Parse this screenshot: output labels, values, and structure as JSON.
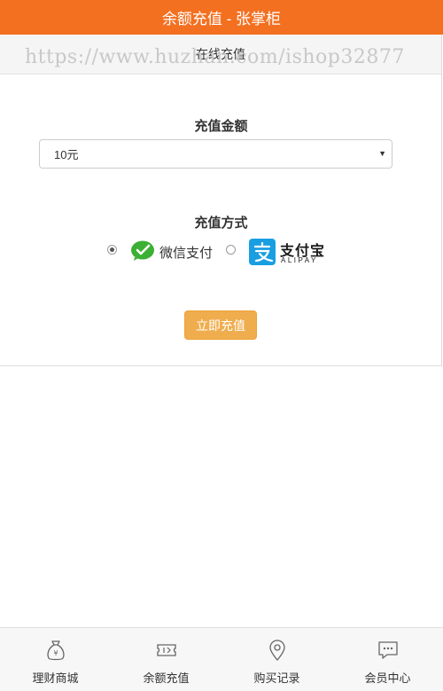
{
  "header": {
    "title": "余额充值 - 张掌柜"
  },
  "card": {
    "title": "在线充值"
  },
  "watermark": "https://www.huzhan.com/ishop32877",
  "form": {
    "amount_label": "充值金额",
    "amount_selected": "10元",
    "method_label": "充值方式",
    "methods": [
      {
        "id": "wechat",
        "label": "微信支付",
        "checked": true
      },
      {
        "id": "alipay",
        "label": "支付宝",
        "sub": "ALIPAY",
        "checked": false
      }
    ],
    "submit_label": "立即充值"
  },
  "colors": {
    "brand": "#f37021",
    "button": "#f0ad4e",
    "wechat": "#3cb034",
    "alipay": "#1a9ee2"
  },
  "tabbar": {
    "items": [
      {
        "label": "理财商城",
        "icon": "money-bag-icon"
      },
      {
        "label": "余额充值",
        "icon": "ticket-icon"
      },
      {
        "label": "购买记录",
        "icon": "location-pin-icon"
      },
      {
        "label": "会员中心",
        "icon": "chat-bubble-icon"
      }
    ]
  }
}
